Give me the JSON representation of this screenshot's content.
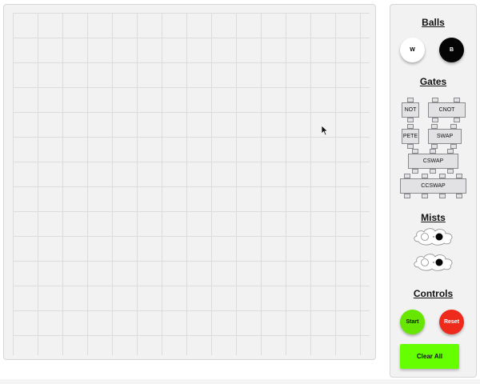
{
  "sections": {
    "balls": "Balls",
    "gates": "Gates",
    "mists": "Mists",
    "controls": "Controls"
  },
  "balls": [
    {
      "label": "W",
      "color": "#ffffff"
    },
    {
      "label": "B",
      "color": "#050505"
    }
  ],
  "gates": [
    "NOT",
    "CNOT",
    "PETE",
    "SWAP",
    "CSWAP",
    "CCSWAP"
  ],
  "controls": {
    "start": "Start",
    "reset": "Reset",
    "clear_all": "Clear All"
  },
  "colors": {
    "start": "#66e600",
    "reset": "#ee2a1b",
    "clear_all": "#66ff00"
  }
}
